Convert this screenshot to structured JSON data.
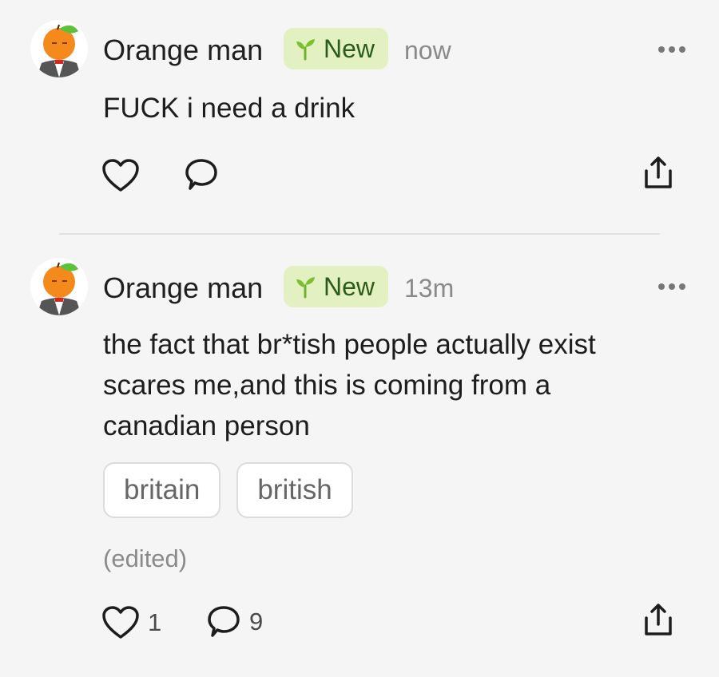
{
  "posts": [
    {
      "author": "Orange man",
      "badge": "New",
      "time": "now",
      "text": "FUCK i need a drink",
      "tags": [],
      "edited": "",
      "likes": "",
      "comments": "",
      "icons": [
        "avatar-orange-man",
        "sprout-icon",
        "more-icon",
        "heart-icon",
        "comment-icon",
        "share-icon"
      ]
    },
    {
      "author": "Orange man",
      "badge": "New",
      "time": "13m",
      "text": "the fact that br*tish people actually exist scares me,and this is coming from a canadian person",
      "tags": [
        "britain",
        "british"
      ],
      "edited": "(edited)",
      "likes": "1",
      "comments": "9",
      "icons": [
        "avatar-orange-man",
        "sprout-icon",
        "more-icon",
        "heart-icon",
        "comment-icon",
        "share-icon"
      ]
    }
  ],
  "colors": {
    "background": "#f5f5f5",
    "badge_bg": "#e3f1c2",
    "badge_text": "#2b5a19",
    "sprout": "#7cbf2f",
    "muted": "#8a8a8a"
  }
}
